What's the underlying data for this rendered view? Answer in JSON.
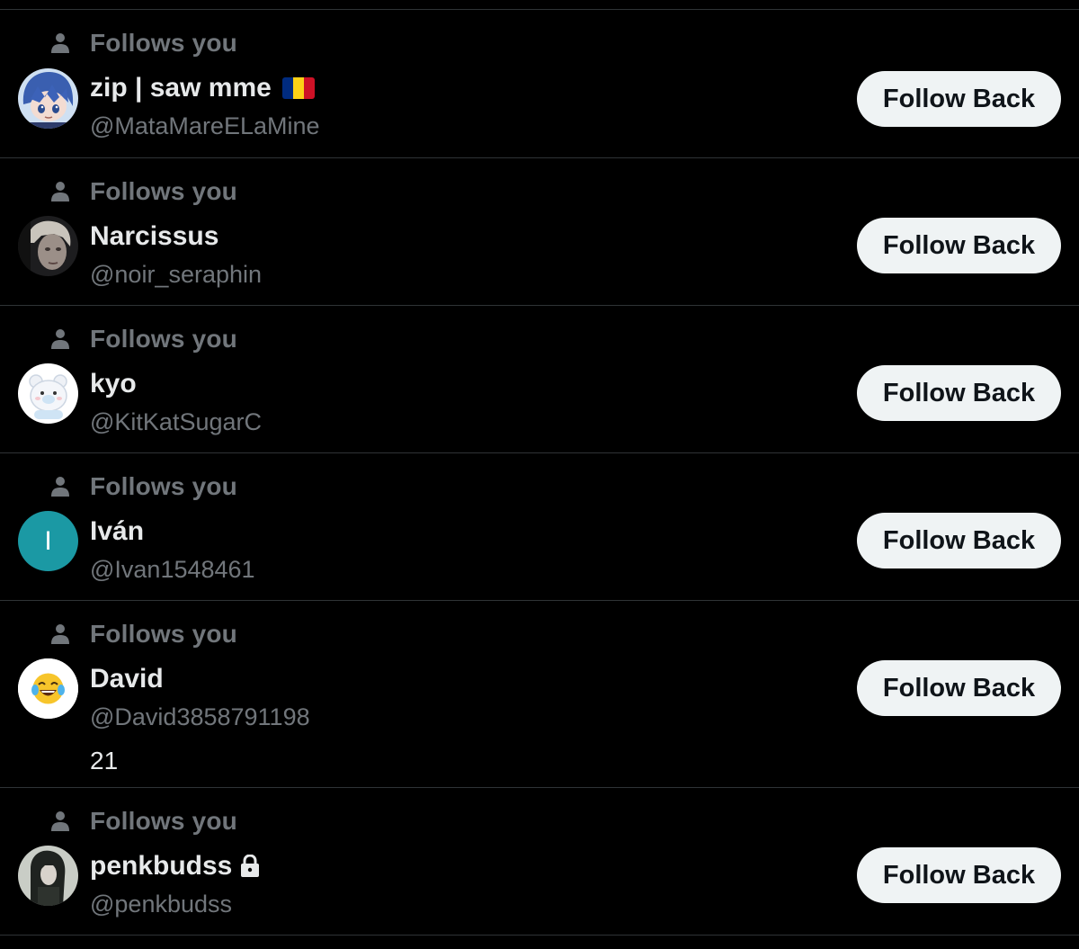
{
  "follows_label": "Follows you",
  "button_label": "Follow Back",
  "users": [
    {
      "name": "zip | saw mme",
      "handle": "@MataMareELaMine",
      "flag": [
        "#002b7f",
        "#fcd116",
        "#ce1126"
      ],
      "flag_name": "romania-flag-icon"
    },
    {
      "name": "Narcissus",
      "handle": "@noir_seraphin"
    },
    {
      "name": "kyo",
      "handle": "@KitKatSugarC"
    },
    {
      "name": "Iván",
      "handle": "@Ivan1548461",
      "avatar_letter": "I",
      "avatar_color": "#1b99a4"
    },
    {
      "name": "David",
      "handle": "@David3858791198",
      "bio": "21"
    },
    {
      "name": "penkbudss",
      "handle": "@penkbudss",
      "protected": true
    }
  ],
  "colors": {
    "background": "#000000",
    "primary_text": "#e7e9ea",
    "secondary_text": "#71767b",
    "divider": "#2f3336",
    "button_bg": "#eff3f4",
    "button_text": "#0f1419"
  }
}
